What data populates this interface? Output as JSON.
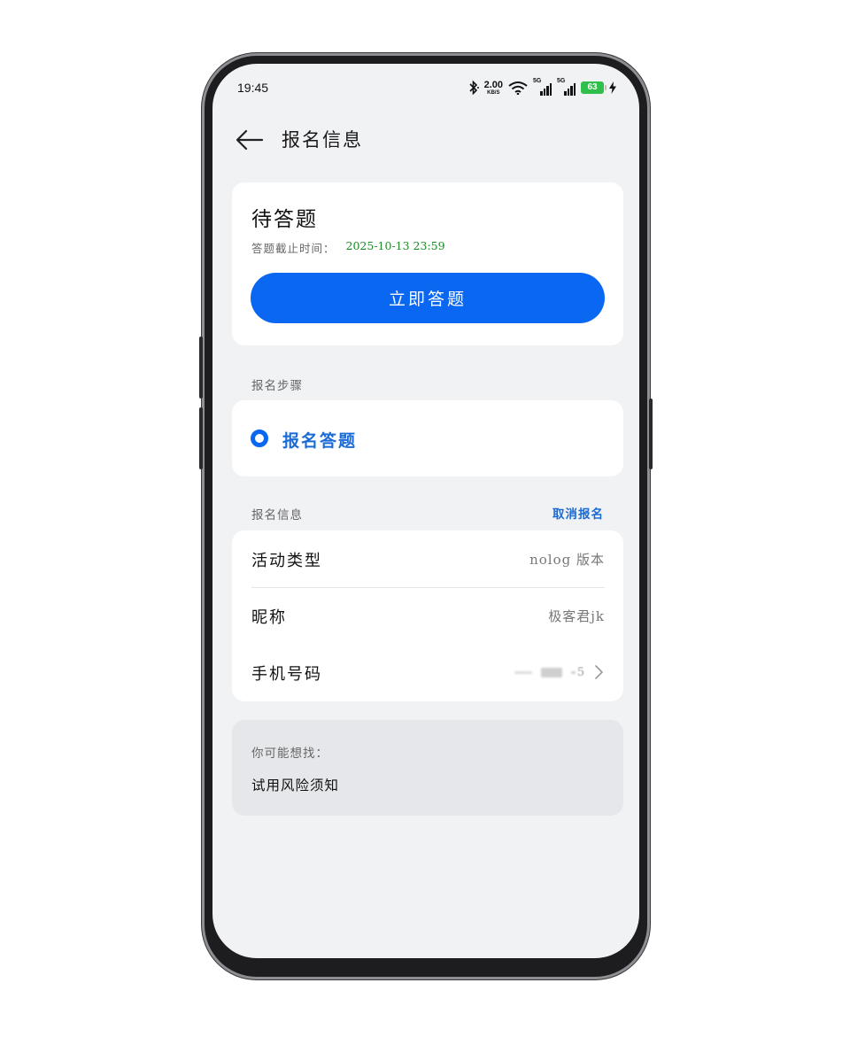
{
  "status_bar": {
    "time": "19:45",
    "net_speed": "2.00",
    "net_unit": "KB/S",
    "signal_1": "5G",
    "signal_2": "5G",
    "battery": "63"
  },
  "header": {
    "title": "报名信息"
  },
  "status_card": {
    "title": "待答题",
    "deadline_label": "答题截止时间：",
    "deadline_value": "2025-10-13  23:59",
    "button_label": "立即答题"
  },
  "steps": {
    "section_label": "报名步骤",
    "items": [
      {
        "label": "报名答题"
      }
    ]
  },
  "info": {
    "section_label": "报名信息",
    "cancel_label": "取消报名",
    "rows": [
      {
        "key": "活动类型",
        "value": "nolog 版本"
      },
      {
        "key": "昵称",
        "value": "极客君jk"
      },
      {
        "key": "手机号码",
        "value": "5"
      }
    ]
  },
  "suggest": {
    "label": "你可能想找：",
    "items": [
      {
        "label": "试用风险须知"
      }
    ]
  },
  "colors": {
    "primary": "#0a67f2",
    "link": "#1a6bd6",
    "deadline": "#1f8a28",
    "battery": "#2fbf4a"
  },
  "icons": {
    "back": "arrow-left-icon",
    "bluetooth": "bluetooth-icon",
    "wifi": "wifi-icon",
    "signal": "signal-icon",
    "battery": "battery-icon",
    "charging": "bolt-icon",
    "chevron": "chevron-right-icon"
  }
}
